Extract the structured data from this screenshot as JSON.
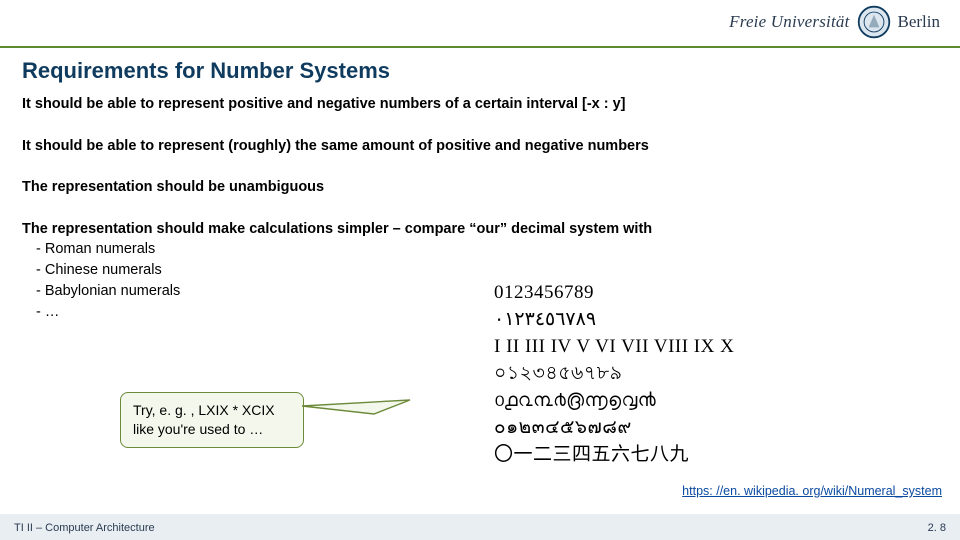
{
  "header": {
    "logo_left": "Freie Universität",
    "logo_right": "Berlin"
  },
  "title": "Requirements for Number Systems",
  "paragraphs": {
    "p1": "It should be able to represent positive and negative numbers of a certain interval [-x : y]",
    "p2": "It should be able to represent (roughly) the same amount of positive and negative numbers",
    "p3": "The representation should be unambiguous",
    "p4_lead": "The representation should make calculations simpler – compare “our” decimal system with",
    "p4_items": {
      "a": "- Roman numerals",
      "b": "- Chinese numerals",
      "c": "- Babylonian numerals",
      "d": "- …"
    }
  },
  "callout": {
    "line1": "Try, e. g. , LXIX * XCIX",
    "line2": "like you're used to …"
  },
  "numeral_rows": {
    "r1": "0123456789",
    "r2": "٠١٢٣٤٥٦٧٨٩",
    "r3": "I II III IV V VI VII VIII IX X",
    "r4": "০১২৩৪৫৬৭৮৯",
    "r5": "൦൧൨൩൪൫൬൭൮൯",
    "r6": "๐๑๒๓๔๕๖๗๘๙",
    "r7": "〇一二三四五六七八九"
  },
  "reference": "https: //en. wikipedia. org/wiki/Numeral_system",
  "footer": {
    "left": "TI II – Computer Architecture",
    "right": "2. 8"
  }
}
